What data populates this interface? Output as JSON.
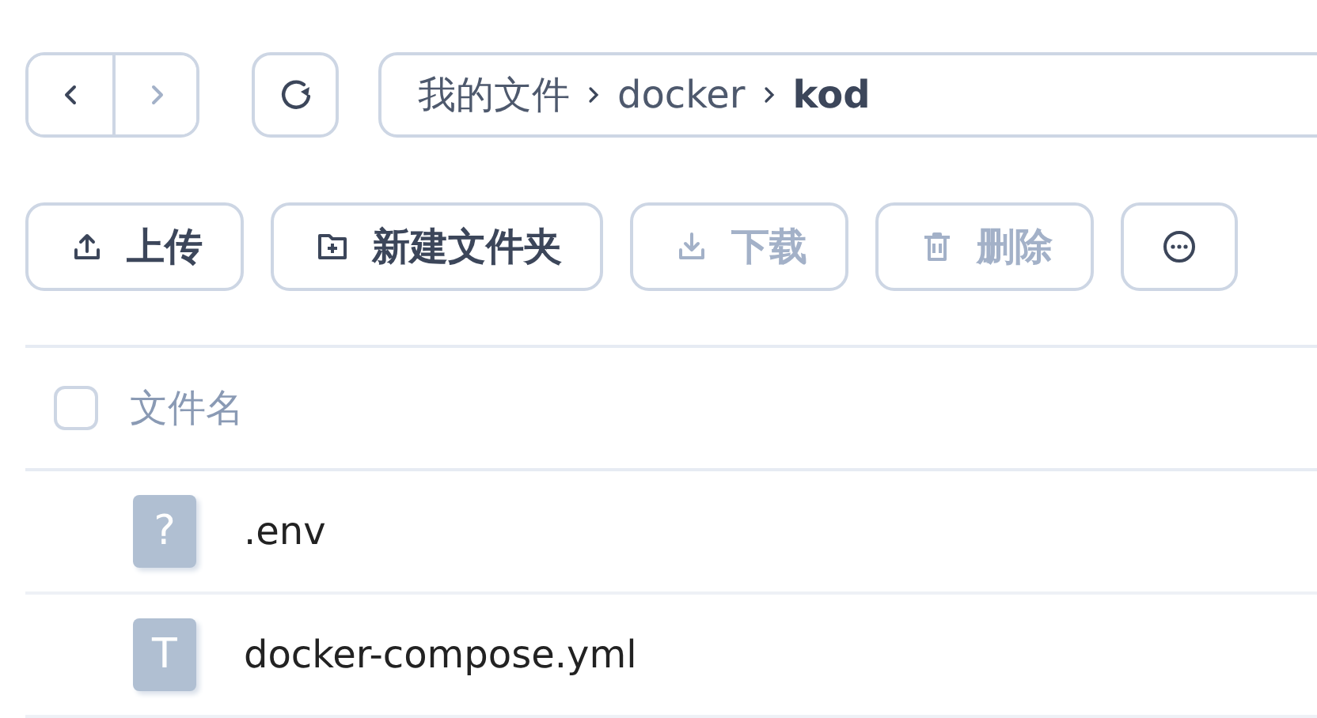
{
  "nav": {
    "back_disabled": false,
    "forward_disabled": true
  },
  "breadcrumb": [
    {
      "label": "我的文件",
      "current": false
    },
    {
      "label": "docker",
      "current": false
    },
    {
      "label": "kod",
      "current": true
    }
  ],
  "toolbar": [
    {
      "kind": "upload",
      "label": "上传",
      "disabled": false
    },
    {
      "kind": "new-folder",
      "label": "新建文件夹",
      "disabled": false
    },
    {
      "kind": "download",
      "label": "下载",
      "disabled": true
    },
    {
      "kind": "delete",
      "label": "删除",
      "disabled": true
    },
    {
      "kind": "more",
      "disabled": false
    }
  ],
  "table": {
    "select_all": {
      "checked": false
    },
    "columns": [
      "文件名"
    ],
    "rows": [
      {
        "glyph": "?",
        "name": ".env"
      },
      {
        "glyph": "T",
        "name": "docker-compose.yml"
      }
    ]
  }
}
